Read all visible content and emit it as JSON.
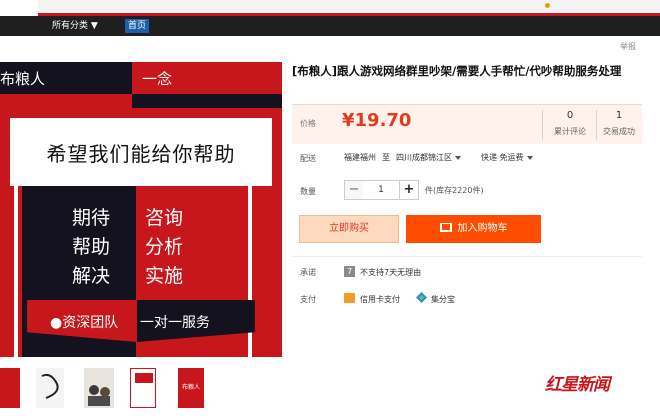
{
  "nav": {
    "all_categories": "所有分类",
    "home": "首页"
  },
  "report_label": "举报",
  "poster": {
    "brand": "布粮人",
    "brand_right": "一念",
    "headline": "希望我们能给你帮助",
    "left_lines": [
      "期待",
      "帮助",
      "解决"
    ],
    "right_lines": [
      "咨询",
      "分析",
      "实施"
    ],
    "bottom_left": "●资深团队",
    "bottom_right": "一对一服务"
  },
  "thumbnails": [
    "",
    "",
    "",
    "",
    "布粮人"
  ],
  "product": {
    "title": "[布粮人]跟人游戏网络群里吵架/需要人手帮忙/代吵帮助服务处理",
    "price_label": "价格",
    "price": "¥19.70",
    "reviews_count": "0",
    "reviews_label": "累计评论",
    "deals_count": "1",
    "deals_label": "交易成功"
  },
  "shipping": {
    "label": "配送",
    "from": "福建福州",
    "to_word": "至",
    "to": "四川成都锦江区",
    "method": "快递 免运费"
  },
  "quantity": {
    "label": "数量",
    "minus": "−",
    "value": "1",
    "plus": "+",
    "stock": "件(库存2220件)"
  },
  "buttons": {
    "buy_now": "立即购买",
    "add_cart": "加入购物车"
  },
  "promise": {
    "label": "承诺",
    "icon_text": "7",
    "text": "不支持7天无理由"
  },
  "payment": {
    "label": "支付",
    "credit": "信用卡支付",
    "jfb": "集分宝"
  },
  "watermark": "红星新闻",
  "colors": {
    "accent_red": "#c8161d",
    "price_orange": "#e4391b",
    "cart_orange": "#ff4d00"
  }
}
